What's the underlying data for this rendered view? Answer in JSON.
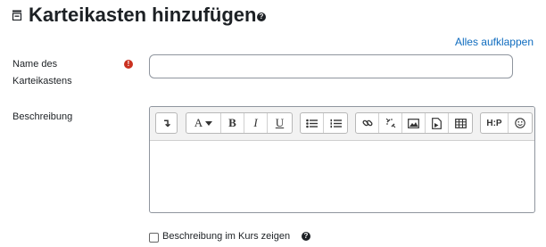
{
  "header": {
    "title": "Karteikasten hinzufügen",
    "help_glyph": "?",
    "icon": "module-icon"
  },
  "expand_all_link": "Alles aufklappen",
  "form": {
    "name_field": {
      "label": "Name des Karteikastens",
      "required_glyph": "!",
      "value": "",
      "placeholder": ""
    },
    "description_field": {
      "label": "Beschreibung",
      "toolbar_groups": [
        [
          "paragraph-styles-icon"
        ],
        [
          "font-size-icon",
          "bold-icon",
          "italic-icon",
          "underline-icon"
        ],
        [
          "bullet-list-icon",
          "numbered-list-icon"
        ],
        [
          "link-icon",
          "unlink-icon",
          "image-icon",
          "media-icon",
          "table-icon"
        ],
        [
          "h5p-icon",
          "emoji-icon"
        ]
      ],
      "toolbar_text": {
        "font": "A",
        "bold": "B",
        "italic": "I",
        "underline": "U",
        "h5p": "H:P",
        "paragraph": "↴"
      },
      "value": ""
    },
    "show_description": {
      "label": "Beschreibung im Kurs zeigen",
      "checked": false,
      "help_glyph": "?"
    }
  },
  "colors": {
    "link": "#0f6cbf",
    "required": "#ca3120",
    "text": "#1d2125"
  }
}
